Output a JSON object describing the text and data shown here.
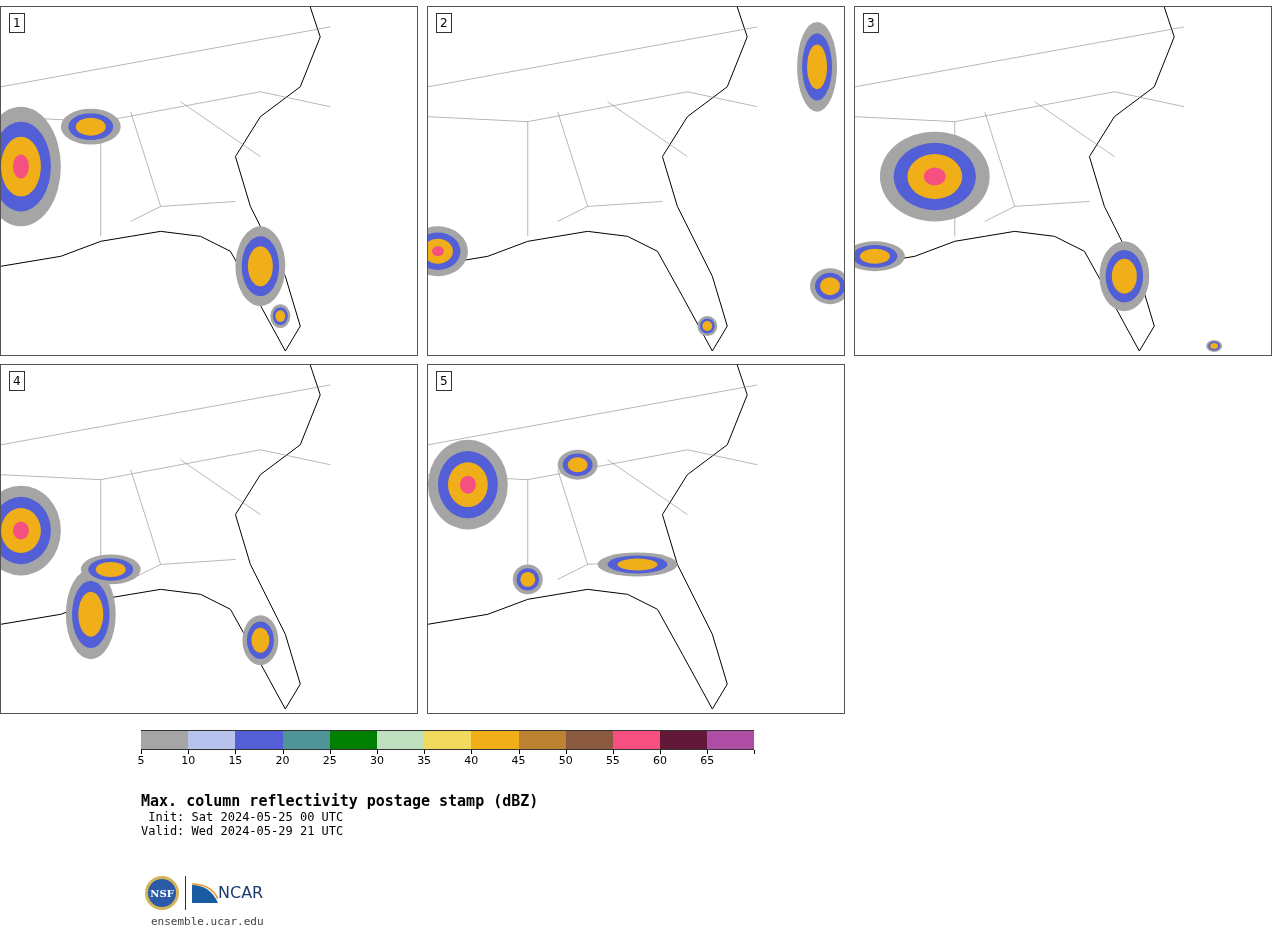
{
  "panels": [
    {
      "label": "1"
    },
    {
      "label": "2"
    },
    {
      "label": "3"
    },
    {
      "label": "4"
    },
    {
      "label": "5"
    }
  ],
  "colorbar": [
    {
      "label": "5",
      "color": "#a5a5a5"
    },
    {
      "label": "10",
      "color": "#b7c3ec"
    },
    {
      "label": "15",
      "color": "#525fd6"
    },
    {
      "label": "20",
      "color": "#4f9598"
    },
    {
      "label": "25",
      "color": "#008000"
    },
    {
      "label": "30",
      "color": "#bfdfbf"
    },
    {
      "label": "35",
      "color": "#f0da5d"
    },
    {
      "label": "40",
      "color": "#f0ae19"
    },
    {
      "label": "45",
      "color": "#bd8232"
    },
    {
      "label": "50",
      "color": "#8b5a3e"
    },
    {
      "label": "55",
      "color": "#f5507f"
    },
    {
      "label": "60",
      "color": "#611937"
    },
    {
      "label": "65",
      "color": "#ad4da4"
    }
  ],
  "title": "Max. column reflectivity postage stamp (dBZ)",
  "init": " Init: Sat 2024-05-25 00 UTC",
  "valid": "Valid: Wed 2024-05-29 21 UTC",
  "logo": {
    "left": "NSF",
    "right": "NCAR"
  },
  "site": "ensemble.ucar.edu"
}
